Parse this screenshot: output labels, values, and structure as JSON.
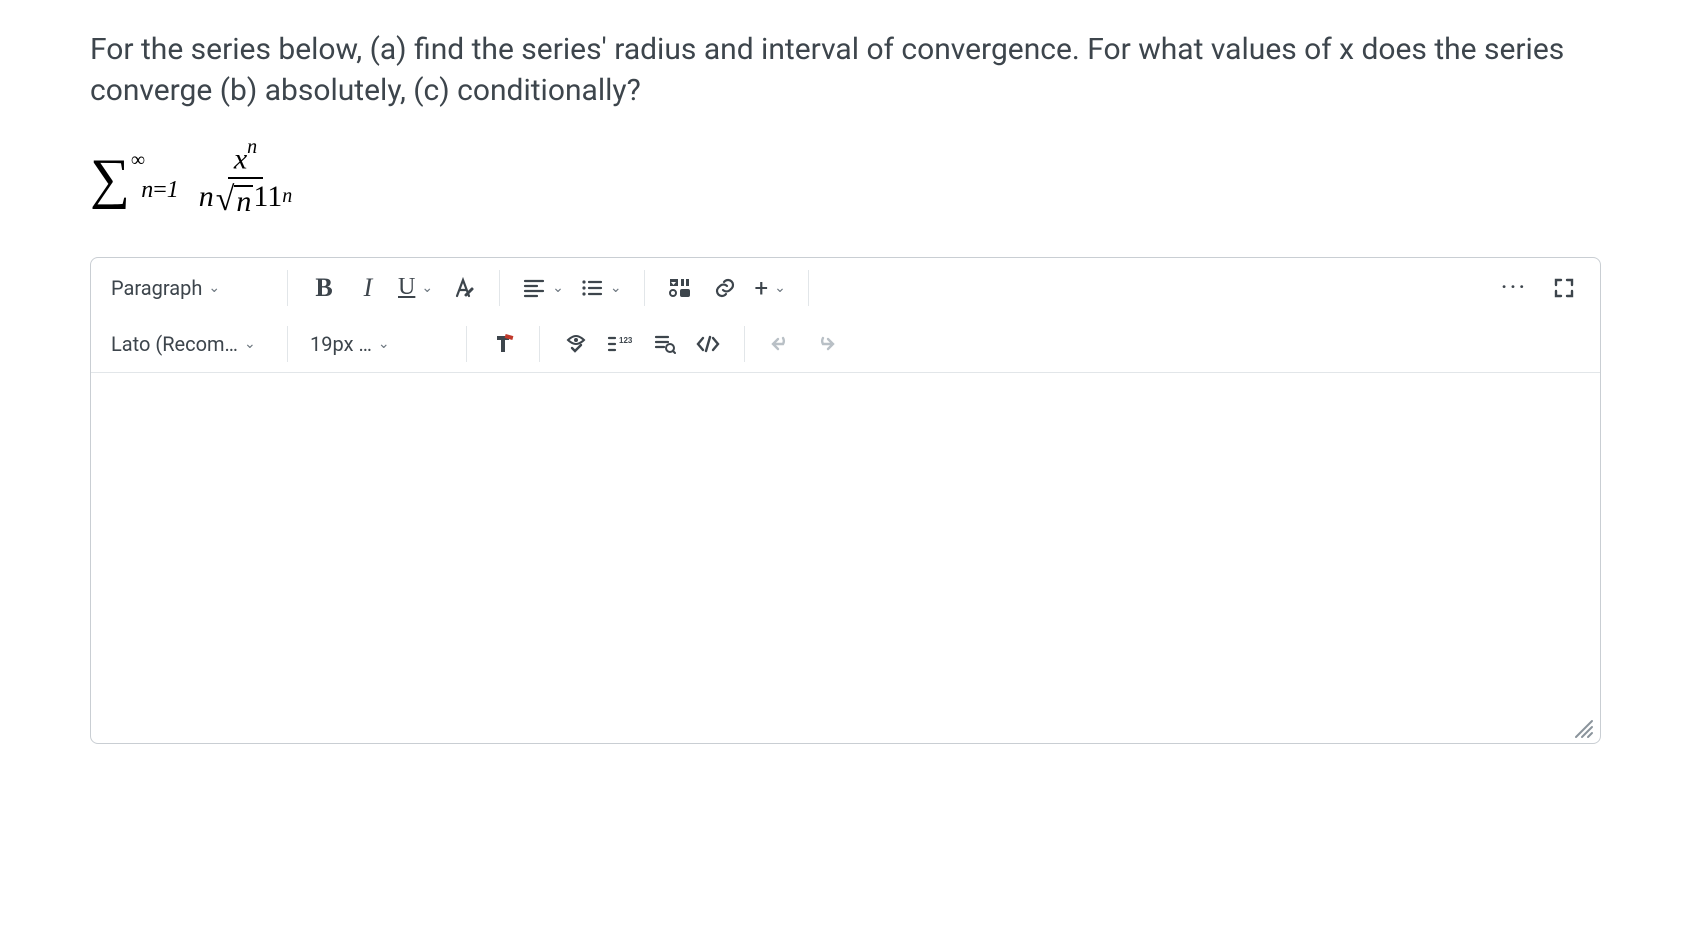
{
  "question": {
    "text": "For the series below, (a) find the series' radius and interval of convergence. For what values of x does the series converge (b) absolutely, (c) conditionally?"
  },
  "formula": {
    "sum_from": "n=1",
    "sum_to": "∞",
    "numerator_base": "x",
    "numerator_exp": "n",
    "denom_lead": "n",
    "denom_radicand": "n",
    "denom_tail": "11",
    "denom_tail_exp": "n"
  },
  "toolbar": {
    "row1": {
      "block_format": "Paragraph",
      "bold": "B",
      "italic": "I",
      "underline": "U",
      "text_color": "A",
      "more": "···",
      "plus": "+"
    },
    "row2": {
      "font_family": "Lato (Recom…",
      "font_size": "19px …"
    }
  }
}
